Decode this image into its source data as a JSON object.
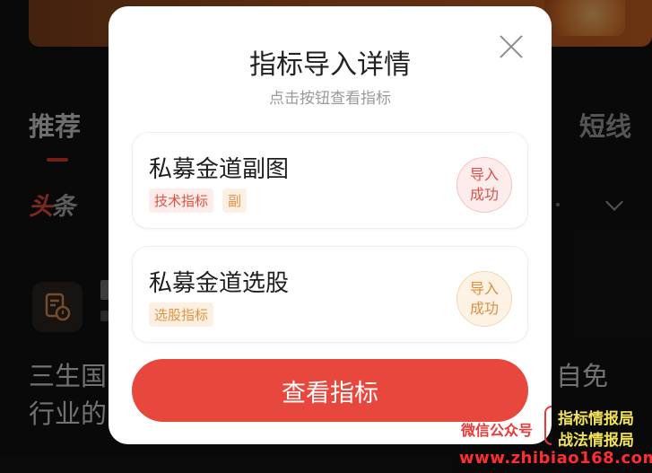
{
  "background": {
    "tabs": {
      "recommend": "推荐",
      "short": "短线"
    },
    "toutiao_logo": {
      "part1": "头",
      "part2": "条"
    },
    "news": {
      "line1_left": "三生国",
      "line1_right": "自免",
      "line2_left": "行业的"
    }
  },
  "modal": {
    "title": "指标导入详情",
    "subtitle": "点击按钮查看指标",
    "close_icon": "close-icon",
    "items": [
      {
        "name": "私募金道副图",
        "tags": [
          "技术指标",
          "副"
        ],
        "status_line1": "导入",
        "status_line2": "成功",
        "accent": "#d9524a"
      },
      {
        "name": "私募金道选股",
        "tags": [
          "选股指标"
        ],
        "status_line1": "导入",
        "status_line2": "成功",
        "accent": "#df8e3e"
      }
    ],
    "button_label": "查看指标",
    "button_color": "#e8473d"
  },
  "watermark": {
    "label": "微信公众号",
    "line1": "指标情报局",
    "line2": "战法情报局",
    "url": "www.zhibiao168.com"
  }
}
